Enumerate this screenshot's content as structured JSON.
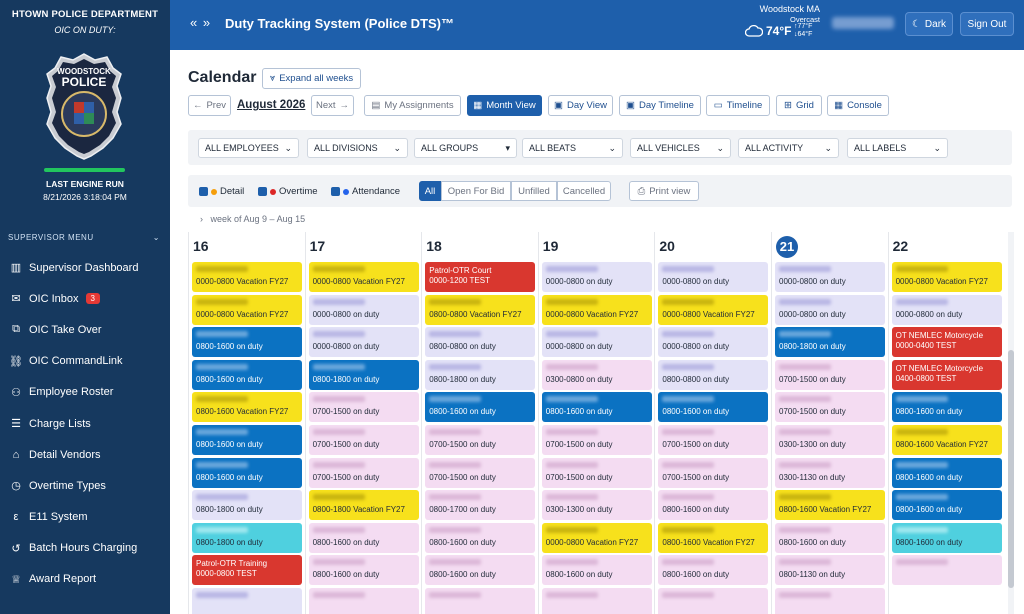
{
  "sidebar": {
    "department": "HTOWN POLICE DEPARTMENT",
    "oic_on_duty": "OIC ON DUTY:",
    "badge": {
      "top": "WOODSTOCK",
      "main": "POLICE"
    },
    "last_engine_run_label": "LAST ENGINE RUN",
    "last_engine_run_time": "8/21/2026 3:18:04 PM",
    "menu_title": "SUPERVISOR MENU",
    "items": [
      {
        "label": "Supervisor Dashboard",
        "icon": "dashboard-icon"
      },
      {
        "label": "OIC Inbox",
        "icon": "inbox-icon",
        "badge": "3"
      },
      {
        "label": "OIC Take Over",
        "icon": "badge-icon"
      },
      {
        "label": "OIC CommandLink",
        "icon": "link-icon"
      },
      {
        "label": "Employee Roster",
        "icon": "people-icon"
      },
      {
        "label": "Charge Lists",
        "icon": "list-icon"
      },
      {
        "label": "Detail Vendors",
        "icon": "bank-icon"
      },
      {
        "label": "Overtime Types",
        "icon": "clock-icon"
      },
      {
        "label": "E11 System",
        "icon": "e11-icon"
      },
      {
        "label": "Batch Hours Charging",
        "icon": "history-icon"
      },
      {
        "label": "Award Report",
        "icon": "trophy-icon"
      }
    ]
  },
  "header": {
    "title": "Duty Tracking System (Police DTS)™",
    "weather": {
      "city": "Woodstock MA",
      "condition": "Overcast",
      "temp": "74°F",
      "high": "↑77°F",
      "low": "↓64°F"
    },
    "dark_label": "Dark",
    "signout_label": "Sign Out"
  },
  "toolbar": {
    "title": "Calendar",
    "expand_label": "Expand all weeks",
    "prev_label": "Prev",
    "month": "August 2026",
    "next_label": "Next",
    "my_assignments": "My Assignments",
    "views": [
      "Month View",
      "Day View",
      "Day Timeline",
      "Timeline",
      "Grid",
      "Console"
    ]
  },
  "filters": [
    "ALL EMPLOYEES",
    "ALL DIVISIONS",
    "ALL GROUPS",
    "ALL BEATS",
    "ALL VEHICLES",
    "ALL ACTIVITY",
    "ALL LABELS"
  ],
  "legend": {
    "detail": "Detail",
    "overtime": "Overtime",
    "attendance": "Attendance",
    "segments": [
      "All",
      "Open For Bid",
      "Unfilled",
      "Cancelled"
    ],
    "print": "Print view"
  },
  "colors": {
    "detail": "#f59e0b",
    "overtime": "#dc2626",
    "attendance": "#2563eb",
    "accent": "#1e5fab"
  },
  "week_label": "week of Aug 9 – Aug 15",
  "days": [
    {
      "num": "16",
      "today": false,
      "shifts": [
        {
          "c": "yellow",
          "t": "0000-0800 Vacation FY27"
        },
        {
          "c": "yellow",
          "t": "0000-0800 Vacation FY27"
        },
        {
          "c": "blue",
          "t": "0800-1600 on duty"
        },
        {
          "c": "blue",
          "t": "0800-1600 on duty"
        },
        {
          "c": "yellow",
          "t": "0800-1600 Vacation FY27"
        },
        {
          "c": "blue",
          "t": "0800-1600 on duty"
        },
        {
          "c": "blue",
          "t": "0800-1600 on duty"
        },
        {
          "c": "lav",
          "t": "0800-1800 on duty"
        },
        {
          "c": "cyan",
          "t": "0800-1800 on duty"
        },
        {
          "c": "red",
          "t": "Patrol-OTR Training",
          "t2": "0000-0800 TEST"
        },
        {
          "c": "lav",
          "t": ""
        }
      ]
    },
    {
      "num": "17",
      "today": false,
      "shifts": [
        {
          "c": "yellow",
          "t": "0000-0800 Vacation FY27"
        },
        {
          "c": "lav",
          "t": "0000-0800 on duty"
        },
        {
          "c": "lav",
          "t": "0000-0800 on duty"
        },
        {
          "c": "blue",
          "t": "0800-1800 on duty"
        },
        {
          "c": "pink",
          "t": "0700-1500 on duty"
        },
        {
          "c": "pink",
          "t": "0700-1500 on duty"
        },
        {
          "c": "pink",
          "t": "0700-1500 on duty"
        },
        {
          "c": "yellow",
          "t": "0800-1800 Vacation FY27"
        },
        {
          "c": "pink",
          "t": "0800-1600 on duty"
        },
        {
          "c": "pink",
          "t": "0800-1600 on duty"
        },
        {
          "c": "pink",
          "t": ""
        }
      ]
    },
    {
      "num": "18",
      "today": false,
      "shifts": [
        {
          "c": "red",
          "t": "Patrol-OTR Court",
          "t2": "0000-1200 TEST"
        },
        {
          "c": "yellow",
          "t": "0800-0800 Vacation FY27"
        },
        {
          "c": "lav",
          "t": "0800-0800 on duty"
        },
        {
          "c": "lav",
          "t": "0800-1800 on duty"
        },
        {
          "c": "blue",
          "t": "0800-1600 on duty"
        },
        {
          "c": "pink",
          "t": "0700-1500 on duty"
        },
        {
          "c": "pink",
          "t": "0700-1500 on duty"
        },
        {
          "c": "pink",
          "t": "0800-1700 on duty"
        },
        {
          "c": "pink",
          "t": "0800-1600 on duty"
        },
        {
          "c": "pink",
          "t": "0800-1600 on duty"
        },
        {
          "c": "pink",
          "t": ""
        }
      ]
    },
    {
      "num": "19",
      "today": false,
      "shifts": [
        {
          "c": "lav",
          "t": "0000-0800 on duty"
        },
        {
          "c": "yellow",
          "t": "0000-0800 Vacation FY27"
        },
        {
          "c": "lav",
          "t": "0000-0800 on duty"
        },
        {
          "c": "pink",
          "t": "0300-0800 on duty"
        },
        {
          "c": "blue",
          "t": "0800-1600 on duty"
        },
        {
          "c": "pink",
          "t": "0700-1500 on duty"
        },
        {
          "c": "pink",
          "t": "0700-1500 on duty"
        },
        {
          "c": "pink",
          "t": "0300-1300 on duty"
        },
        {
          "c": "yellow",
          "t": "0000-0800 Vacation FY27"
        },
        {
          "c": "pink",
          "t": "0800-1600 on duty"
        },
        {
          "c": "pink",
          "t": ""
        }
      ]
    },
    {
      "num": "20",
      "today": false,
      "shifts": [
        {
          "c": "lav",
          "t": "0000-0800 on duty"
        },
        {
          "c": "yellow",
          "t": "0000-0800 Vacation FY27"
        },
        {
          "c": "lav",
          "t": "0000-0800 on duty"
        },
        {
          "c": "lav",
          "t": "0800-0800 on duty"
        },
        {
          "c": "blue",
          "t": "0800-1600 on duty"
        },
        {
          "c": "pink",
          "t": "0700-1500 on duty"
        },
        {
          "c": "pink",
          "t": "0700-1500 on duty"
        },
        {
          "c": "pink",
          "t": "0800-1600 on duty"
        },
        {
          "c": "yellow",
          "t": "0800-1600 Vacation FY27"
        },
        {
          "c": "pink",
          "t": "0800-1600 on duty"
        },
        {
          "c": "pink",
          "t": ""
        }
      ]
    },
    {
      "num": "21",
      "today": true,
      "shifts": [
        {
          "c": "lav",
          "t": "0000-0800 on duty"
        },
        {
          "c": "lav",
          "t": "0000-0800 on duty"
        },
        {
          "c": "blue",
          "t": "0800-1800 on duty"
        },
        {
          "c": "pink",
          "t": "0700-1500 on duty"
        },
        {
          "c": "pink",
          "t": "0700-1500 on duty"
        },
        {
          "c": "pink",
          "t": "0300-1300 on duty"
        },
        {
          "c": "pink",
          "t": "0300-1130 on duty"
        },
        {
          "c": "yellow",
          "t": "0800-1600 Vacation FY27"
        },
        {
          "c": "pink",
          "t": "0800-1600 on duty"
        },
        {
          "c": "pink",
          "t": "0800-1130 on duty"
        },
        {
          "c": "pink",
          "t": ""
        }
      ]
    },
    {
      "num": "22",
      "today": false,
      "shifts": [
        {
          "c": "yellow",
          "t": "0000-0800 Vacation FY27"
        },
        {
          "c": "lav",
          "t": "0000-0800 on duty"
        },
        {
          "c": "red",
          "t": "OT NEMLEC Motorcycle",
          "t2": "0000-0400 TEST"
        },
        {
          "c": "red",
          "t": "OT NEMLEC Motorcycle",
          "t2": "0400-0800 TEST"
        },
        {
          "c": "blue",
          "t": "0800-1600 on duty"
        },
        {
          "c": "yellow",
          "t": "0800-1600 Vacation FY27"
        },
        {
          "c": "blue",
          "t": "0800-1600 on duty"
        },
        {
          "c": "blue",
          "t": "0800-1600 on duty"
        },
        {
          "c": "cyan",
          "t": "0800-1600 on duty"
        },
        {
          "c": "pink",
          "t": ""
        }
      ]
    }
  ]
}
